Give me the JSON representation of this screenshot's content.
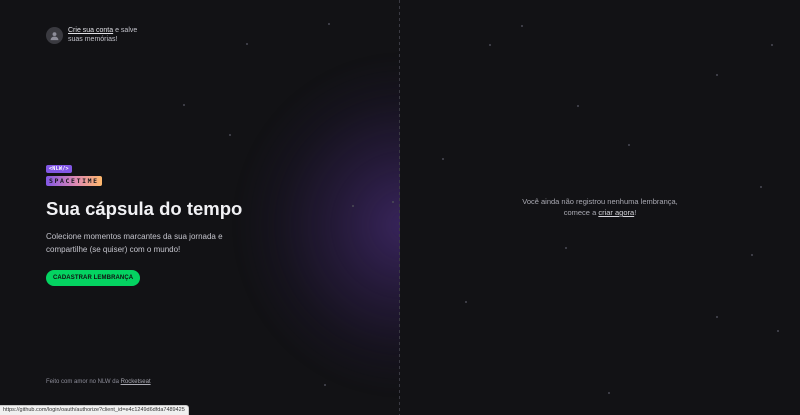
{
  "account": {
    "link_text": "Crie sua conta",
    "text_suffix": " e salve suas memórias!"
  },
  "hero": {
    "logo_top": "<NLW/>",
    "logo_bottom": "SPACETIME",
    "title": "Sua cápsula do tempo",
    "subtitle": "Colecione momentos marcantes da sua jornada e compartilhe (se quiser) com o mundo!",
    "cta_label": "CADASTRAR LEMBRANÇA"
  },
  "footer": {
    "prefix": "Feito com amor no NLW da ",
    "link_text": "Rocketseat"
  },
  "empty_state": {
    "line1": "Você ainda não registrou nenhuma lembrança,",
    "line2_prefix": "comece a ",
    "link_text": "criar agora",
    "line2_suffix": "!"
  },
  "statusbar": {
    "url": "https://github.com/login/oauth/authorize?client_id=e4c1249d6dfda7489425"
  },
  "colors": {
    "background": "#121215",
    "accent_green": "#04d361",
    "accent_purple": "#8257e5"
  },
  "icons": {
    "avatar": "user-icon"
  }
}
